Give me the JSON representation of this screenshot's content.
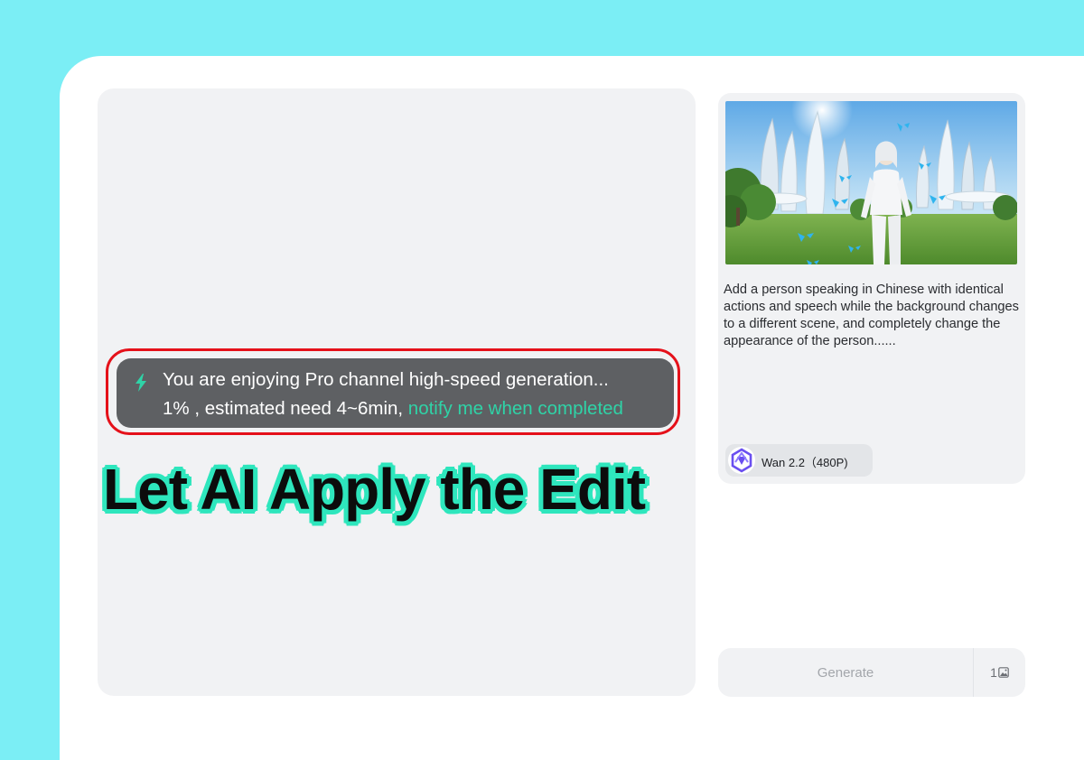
{
  "preview": {
    "toast": {
      "line1": "You are enjoying Pro channel high-speed generation...",
      "progress_text": "1% , estimated need 4~6min, ",
      "notify_link": "notify me when completed",
      "progress_percent": 1
    },
    "caption": "Let AI Apply the Edit"
  },
  "task": {
    "prompt": "Add a person speaking in Chinese with identical actions and speech while the background changes to a different scene, and completely change the appearance of the person......",
    "model_label": "Wan 2.2（480P)"
  },
  "actions": {
    "generate_label": "Generate",
    "count": "1"
  },
  "icons": {
    "toast": "lightning-bolt-icon",
    "model": "qwen-logo-icon",
    "count": "image-icon"
  },
  "colors": {
    "background": "#7beef5",
    "accent": "#2fd3a7",
    "highlight": "#e5111a",
    "caption_stroke": "#2ee6bd"
  }
}
